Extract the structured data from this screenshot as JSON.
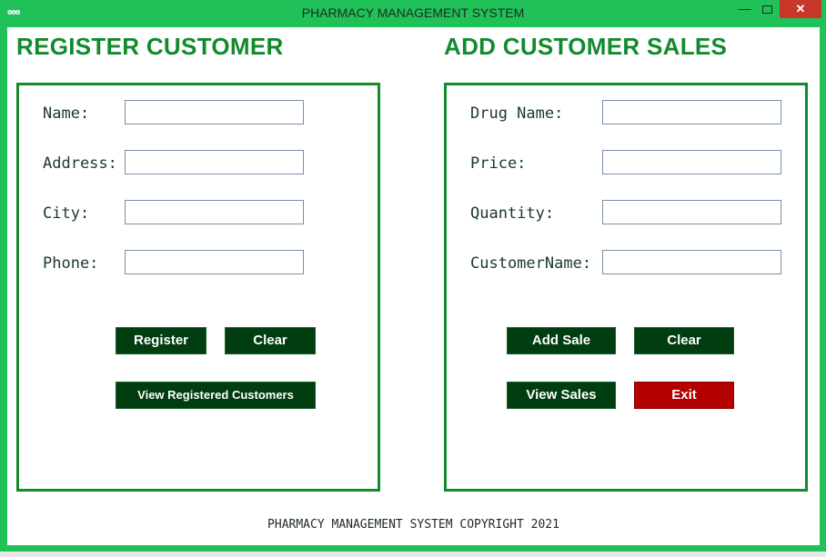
{
  "window": {
    "title": "PHARMACY MANAGEMENT SYSTEM",
    "icon_name": "app-icon",
    "icon_glyph": "ʘʘʘ",
    "minimize_glyph": "—",
    "close_glyph": "✕"
  },
  "register": {
    "heading": "REGISTER CUSTOMER",
    "fields": {
      "name_label": "Name:",
      "address_label": "Address:",
      "city_label": "City:",
      "phone_label": "Phone:"
    },
    "buttons": {
      "register": "Register",
      "clear": "Clear",
      "view": "View Registered Customers"
    }
  },
  "sales": {
    "heading": "ADD CUSTOMER SALES",
    "fields": {
      "drug_label": "Drug Name:",
      "price_label": "Price:",
      "quantity_label": "Quantity:",
      "customer_label": "CustomerName:"
    },
    "buttons": {
      "add_sale": "Add Sale",
      "clear": "Clear",
      "view_sales": "View Sales",
      "exit": "Exit"
    }
  },
  "footer": "PHARMACY MANAGEMENT SYSTEM COPYRIGHT 2021",
  "colors": {
    "window_frame": "#21c15a",
    "heading_green": "#128a2e",
    "button_green": "#003d10",
    "exit_red": "#b30000"
  }
}
